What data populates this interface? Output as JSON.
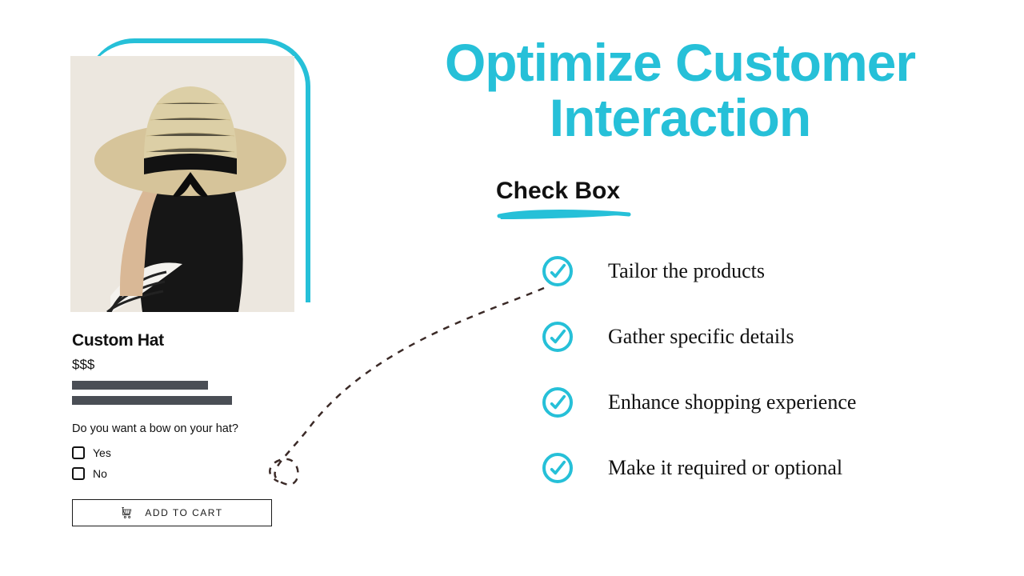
{
  "product": {
    "title": "Custom Hat",
    "price": "$$$",
    "question": "Do you want a bow on your hat?",
    "options": [
      "Yes",
      "No"
    ],
    "cta": "ADD TO CART"
  },
  "headline": "Optimize Customer Interaction",
  "subhead": "Check Box",
  "benefits": [
    "Tailor the products",
    "Gather specific details",
    "Enhance shopping experience",
    "Make it required or optional"
  ],
  "colors": {
    "accent": "#26c0d8"
  }
}
